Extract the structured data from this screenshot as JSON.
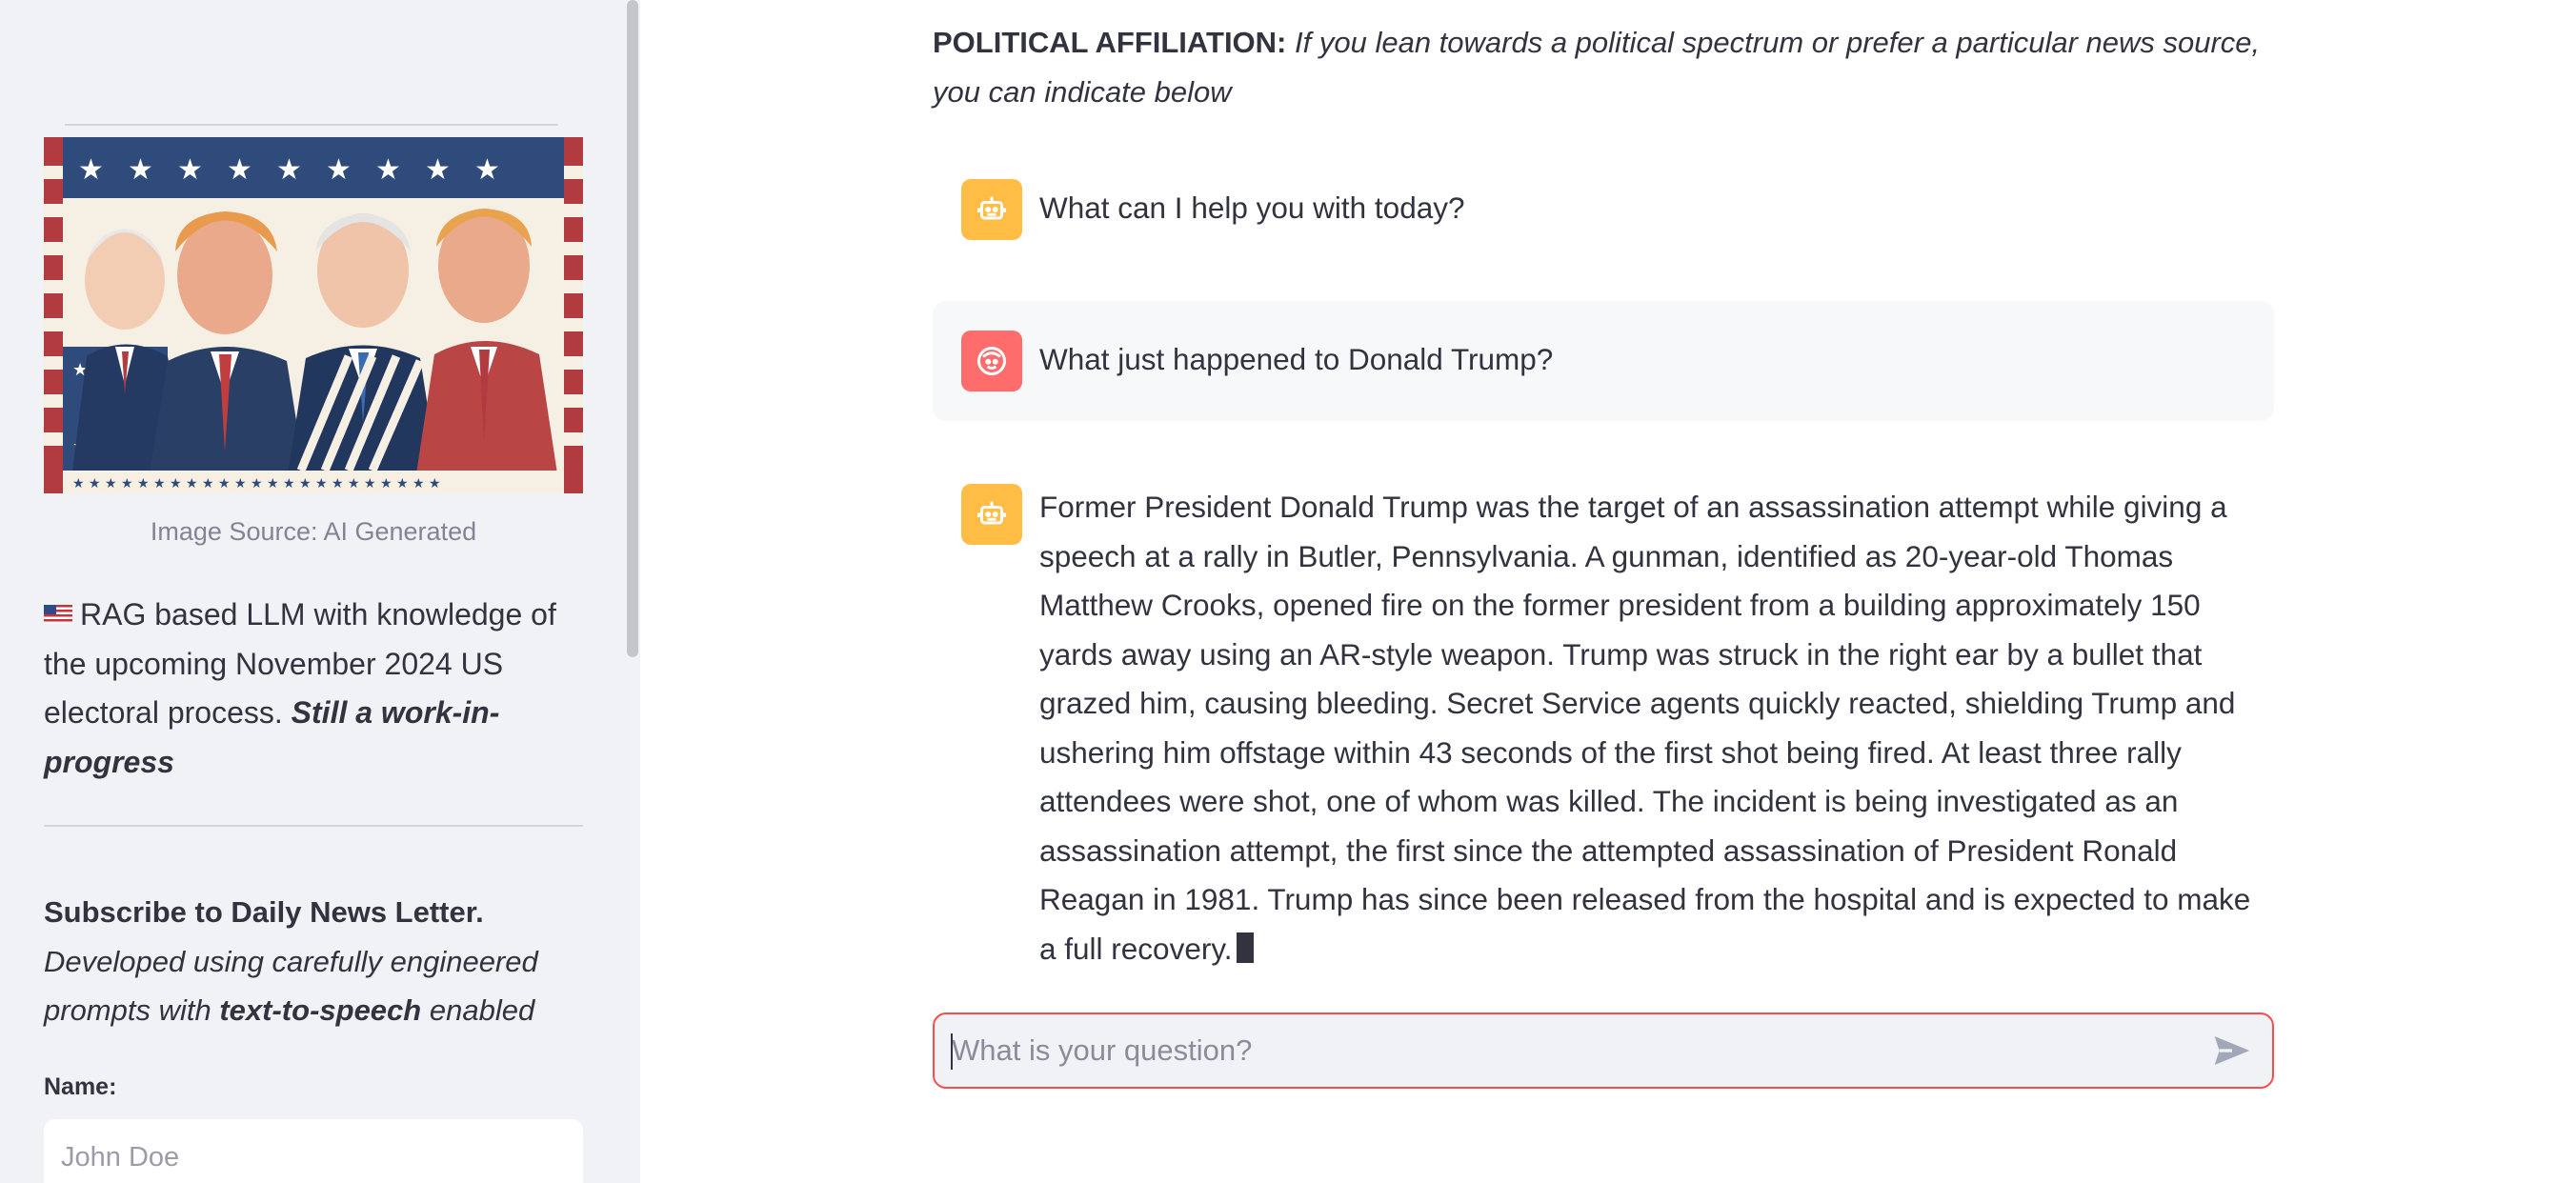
{
  "sidebar": {
    "image_caption": "Image Source: AI Generated",
    "desc_flag": "us-flag-emoji",
    "desc_main": "RAG based LLM with knowledge of the upcoming November 2024 US electoral process.",
    "desc_em": "Still a work-in-progress",
    "subscribe_title": "Subscribe to Daily News Letter.",
    "subscribe_part1": "Developed using carefully engineered prompts with",
    "subscribe_bold": "text-to-speech",
    "subscribe_part2": "enabled",
    "name_label": "Name:",
    "name_placeholder": "John Doe"
  },
  "main": {
    "affiliation_label": "POLITICAL AFFILIATION:",
    "affiliation_text": "If you lean towards a political spectrum or prefer a particular news source, you can indicate below",
    "messages": [
      {
        "role": "assistant",
        "text": "What can I help you with today?"
      },
      {
        "role": "user",
        "text": "What just happened to Donald Trump?"
      },
      {
        "role": "assistant",
        "text": "Former President Donald Trump was the target of an assassination attempt while giving a speech at a rally in Butler, Pennsylvania. A gunman, identified as 20-year-old Thomas Matthew Crooks, opened fire on the former president from a building approximately 150 yards away using an AR-style weapon. Trump was struck in the right ear by a bullet that grazed him, causing bleeding. Secret Service agents quickly reacted, shielding Trump and ushering him offstage within 43 seconds of the first shot being fired. At least three rally attendees were shot, one of whom was killed. The incident is being investigated as an assassination attempt, the first since the attempted assassination of President Ronald Reagan in 1981. Trump has since been released from the hospital and is expected to make a full recovery."
      }
    ],
    "chat_placeholder": "What is your question?"
  },
  "colors": {
    "sidebar_bg": "#f0f2f6",
    "bot_avatar": "#ffbd45",
    "user_avatar": "#ff6c6c",
    "accent_red": "#ff4b4b",
    "text": "#31333f"
  },
  "icons": {
    "bot_avatar": "robot-face-icon",
    "user_avatar": "user-face-icon",
    "send": "send-arrow-icon"
  }
}
